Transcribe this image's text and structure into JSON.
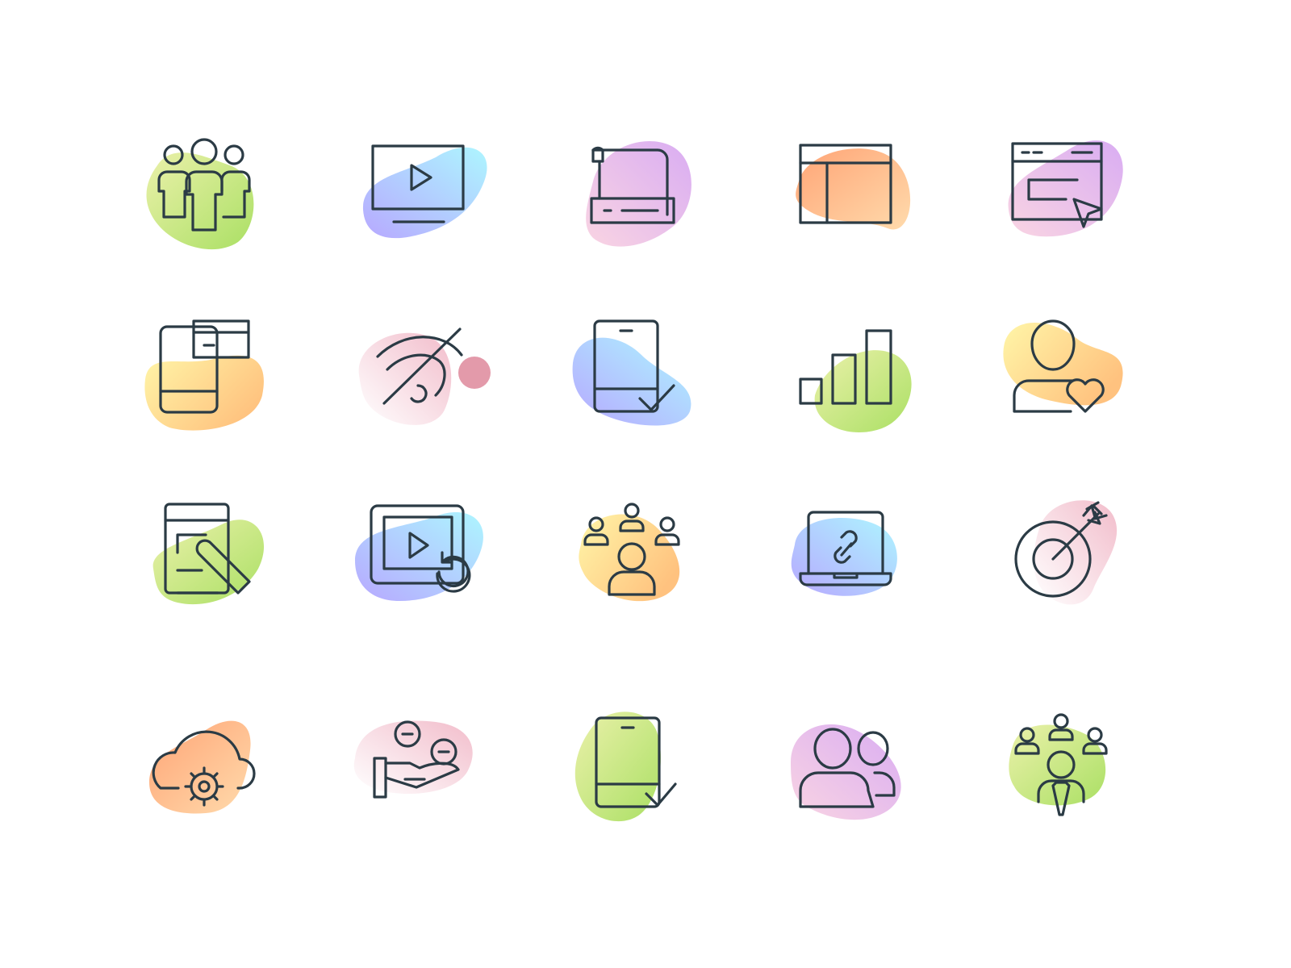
{
  "palette": {
    "line": "#2b3b45",
    "green": [
      "#a6de5c",
      "#e6ef9c"
    ],
    "blue": [
      "#a9f5ff",
      "#b3a4ff"
    ],
    "purple": [
      "#d7a8f2",
      "#f9cfe0"
    ],
    "orange": [
      "#ff9f6e",
      "#ffd6a5"
    ],
    "yellow": [
      "#fff3a0",
      "#ffc37a"
    ],
    "pink": [
      "#f6c4d1",
      "#ffffff"
    ],
    "rose": "#e39aaa"
  },
  "icons": [
    {
      "name": "team-icon",
      "blob": "green"
    },
    {
      "name": "video-monitor-icon",
      "blob": "blue"
    },
    {
      "name": "dev-scroll-icon",
      "blob": "purple"
    },
    {
      "name": "layout-grid-icon",
      "blob": "orange"
    },
    {
      "name": "browser-click-icon",
      "blob": "purple"
    },
    {
      "name": "mobile-cards-icon",
      "blob": "yellow"
    },
    {
      "name": "hidden-eye-icon",
      "blob": "pink"
    },
    {
      "name": "mobile-check-icon",
      "blob": "blue"
    },
    {
      "name": "bar-chart-icon",
      "blob": "green"
    },
    {
      "name": "user-heart-icon",
      "blob": "yellow"
    },
    {
      "name": "mobile-edit-icon",
      "blob": "green"
    },
    {
      "name": "video-replay-icon",
      "blob": "blue"
    },
    {
      "name": "audience-icon",
      "blob": "yellow"
    },
    {
      "name": "laptop-link-icon",
      "blob": "blue"
    },
    {
      "name": "target-arrow-icon",
      "blob": "pink"
    },
    {
      "name": "cloud-settings-icon",
      "blob": "orange"
    },
    {
      "name": "hand-coins-icon",
      "blob": "pink"
    },
    {
      "name": "phone-check-icon",
      "blob": "green"
    },
    {
      "name": "users-pair-icon",
      "blob": "purple"
    },
    {
      "name": "leader-team-icon",
      "blob": "green"
    }
  ]
}
